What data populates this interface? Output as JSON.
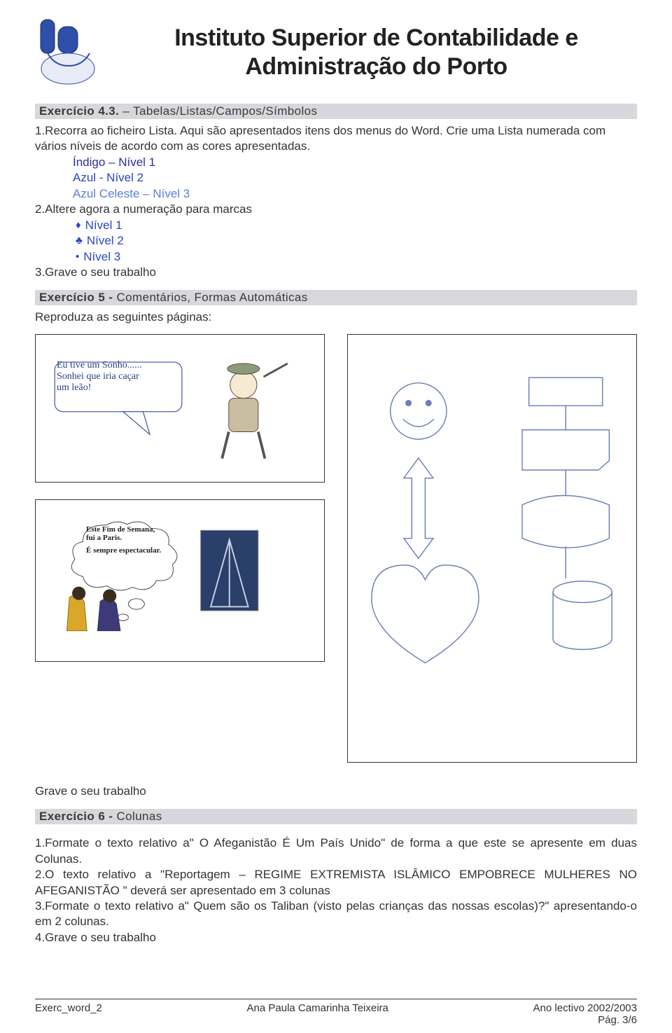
{
  "header": {
    "institution_line1": "Instituto Superior de Contabilidade e",
    "institution_line2": "Administração do Porto"
  },
  "ex43": {
    "title_bold": "Exercício 4.3.",
    "title_rest": " – Tabelas/Listas/Campos/Símbolos",
    "p1": "1.Recorra ao ficheiro Lista. Aqui são apresentados itens dos menus do Word. Crie uma Lista numerada com vários níveis de acordo com as cores apresentadas.",
    "indigo": "Índigo – Nível 1",
    "azul": "Azul - Nível 2",
    "azulc": "Azul Celeste – Nível 3",
    "p2": "2.Altere agora a numeração para marcas",
    "m1": "Nível 1",
    "m2": "Nível 2",
    "m3": "Nível 3",
    "p3": "3.Grave o seu trabalho"
  },
  "ex5": {
    "title_bold": "Exercício 5 -",
    "title_rest": " Comentários, Formas Automáticas",
    "sub": "Reproduza as seguintes páginas:",
    "speech1": "Eu tive um Sonho......\nSonhei que iria caçar\num leão!",
    "speech2_a": "Este Fim de Semana,\nfui a Paris.",
    "speech2_b": "É sempre espectacular.",
    "save": "Grave o seu trabalho"
  },
  "ex6": {
    "title_bold": "Exercício 6 -",
    "title_rest": " Colunas",
    "p1": "1.Formate o texto relativo a\" O Afeganistão É Um País Unido\" de forma a que este se apresente em duas Colunas.",
    "p2": "2.O texto relativo a \"Reportagem – REGIME EXTREMISTA ISLÂMICO EMPOBRECE MULHERES NO AFEGANISTÃO \" deverá ser apresentado em 3 colunas",
    "p3": "3.Formate o texto relativo a\" Quem são os Taliban (visto pelas crianças das nossas escolas)?\" apresentando-o em 2 colunas.",
    "p4": "4.Grave o seu trabalho"
  },
  "footer": {
    "left": "Exerc_word_2",
    "center": "Ana Paula Camarinha Teixeira",
    "right1": "Ano lectivo 2002/2003",
    "right2": "Pág. 3/6"
  }
}
